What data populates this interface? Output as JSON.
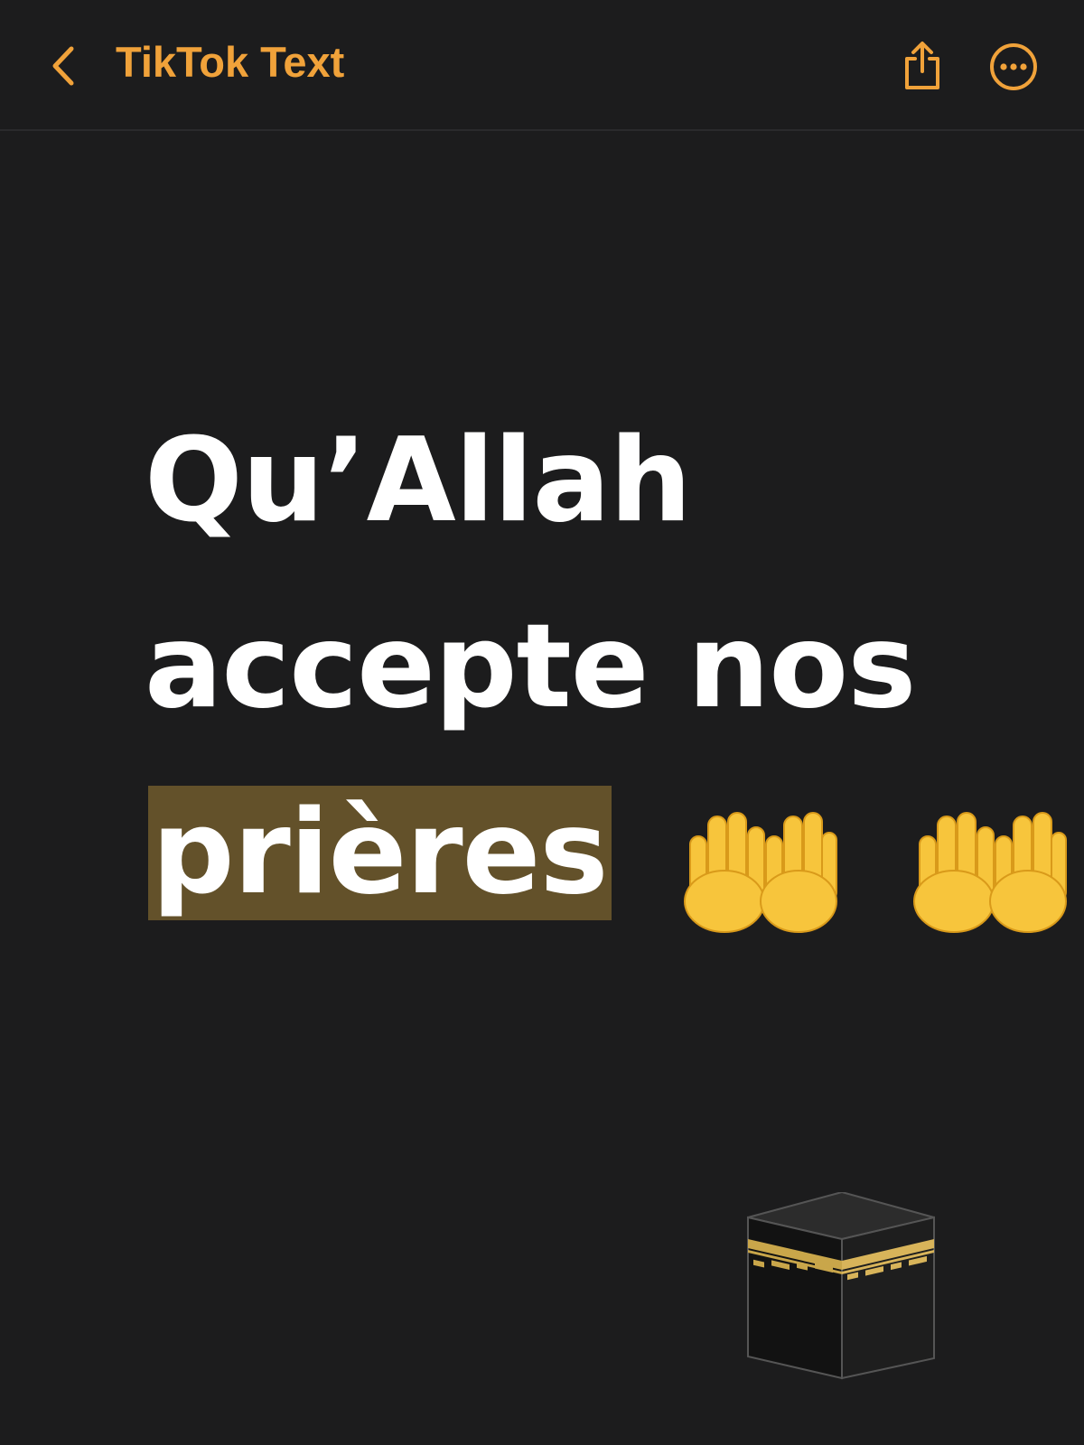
{
  "nav": {
    "back_icon": "chevron-left-icon",
    "title": "TikTok Text",
    "share_icon": "share-icon",
    "more_icon": "ellipsis-circle-icon",
    "accent_color": "#f0a23a"
  },
  "note": {
    "line1": "Qu’Allah",
    "line2": "accepte nos",
    "line3_highlighted": "prières",
    "emoji": [
      "palms-up-together-icon",
      "palms-up-together-icon"
    ],
    "highlight_color": "#63512a",
    "text_color": "#ffffff",
    "background_color": "#1c1c1d"
  },
  "decoration": {
    "icon": "kaaba-icon"
  }
}
